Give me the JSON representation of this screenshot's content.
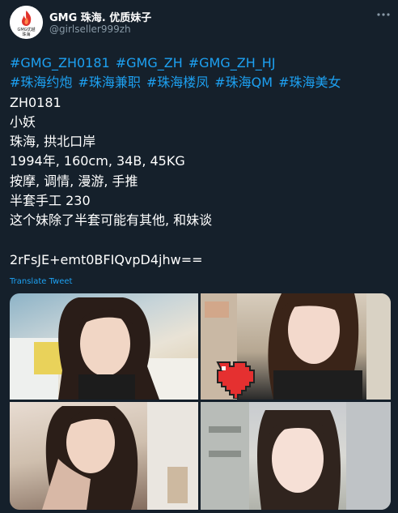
{
  "account": {
    "display_name": "GMG 珠海. 优质妹子",
    "handle": "@girlseller999zh",
    "avatar_text": "GMG优越\n珠海"
  },
  "tweet": {
    "hashtags_line1": [
      "#GMG_ZH0181",
      "#GMG_ZH",
      "#GMG_ZH_HJ"
    ],
    "hashtags_line2": [
      "#珠海约炮",
      "#珠海兼职",
      "#珠海楼凤",
      "#珠海QM",
      "#珠海美女"
    ],
    "lines": [
      "ZH0181",
      "小妖",
      "珠海, 拱北口岸",
      "1994年, 160cm, 34B, 45KG",
      "按摩, 调情, 漫游, 手推",
      "半套手工 230",
      "这个妹除了半套可能有其他, 和妹谈"
    ],
    "code": "2rFsJE+emt0BFIQvpD4jhw==",
    "translate_label": "Translate Tweet"
  },
  "icons": {
    "more": "more-horizontal-icon",
    "avatar": "flame-logo-icon",
    "heart_sticker": "pixel-heart-icon"
  },
  "colors": {
    "background": "#15202b",
    "link": "#1da1f2",
    "secondary_text": "#8899a6",
    "brand_red": "#e0322c"
  }
}
